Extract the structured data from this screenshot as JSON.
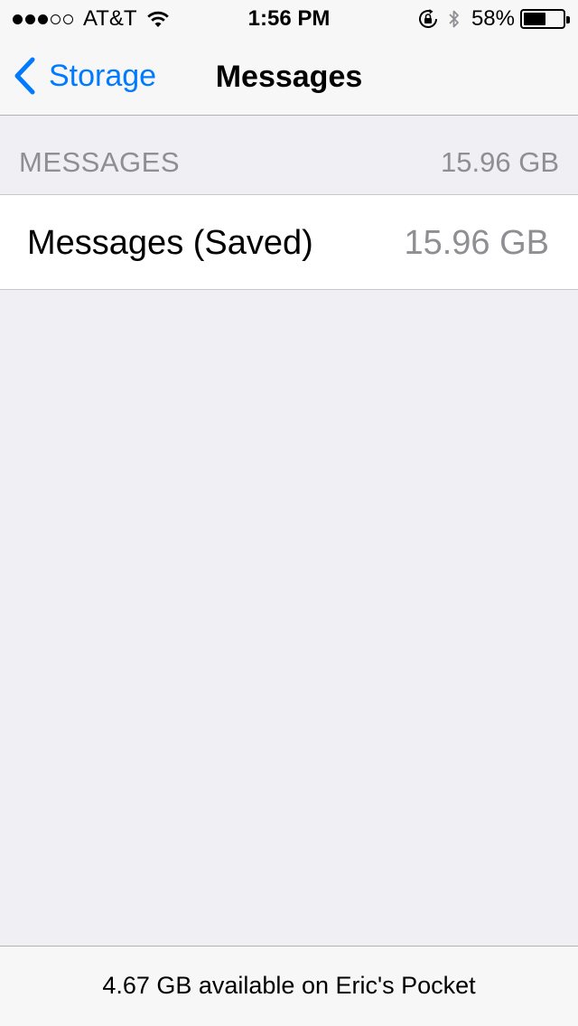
{
  "status_bar": {
    "signal_bars_full": 3,
    "signal_bars_total": 5,
    "carrier": "AT&T",
    "time": "1:56 PM",
    "battery_percent": "58%",
    "battery_level": 0.58,
    "icons": [
      "wifi-icon",
      "rotation-lock-icon",
      "bluetooth-icon",
      "battery-icon"
    ]
  },
  "nav": {
    "back_label": "Storage",
    "title": "Messages",
    "accent_color": "#007aff"
  },
  "section": {
    "title": "MESSAGES",
    "size": "15.96 GB"
  },
  "rows": [
    {
      "label": "Messages (Saved)",
      "size": "15.96 GB"
    }
  ],
  "footer": {
    "available_text": "4.67 GB available on Eric's Pocket"
  }
}
